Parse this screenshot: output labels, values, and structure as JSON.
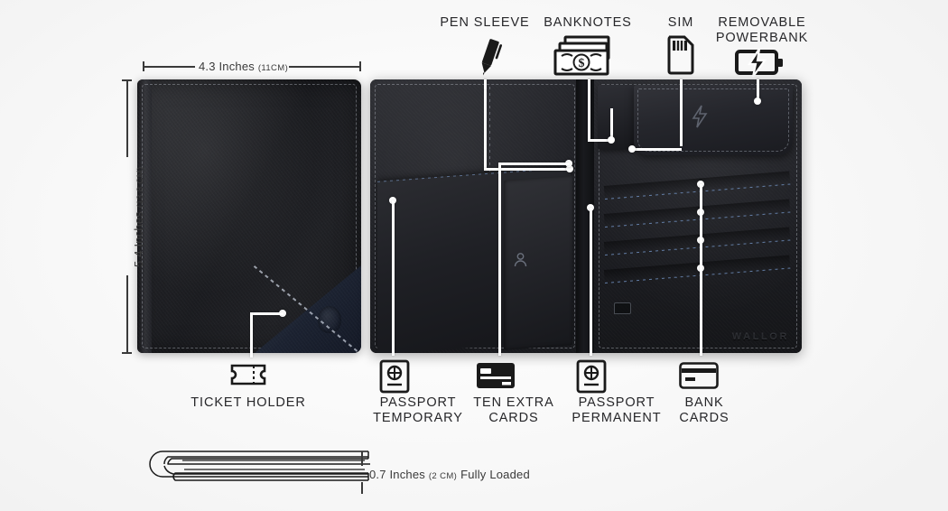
{
  "background_color": "#fbfbfb",
  "brand": {
    "emboss_text": "WALLOR"
  },
  "top_features": [
    {
      "id": "pen-sleeve",
      "label": "PEN SLEEVE",
      "icon": "pen-icon"
    },
    {
      "id": "banknotes",
      "label": "BANKNOTES",
      "icon": "banknotes-icon"
    },
    {
      "id": "sim",
      "label": "SIM",
      "icon": "sim-card-icon"
    },
    {
      "id": "removable-powerbank",
      "label": "REMOVABLE\nPOWERBANK",
      "icon": "battery-bolt-icon"
    }
  ],
  "bottom_features": [
    {
      "id": "ticket-holder",
      "label": "TICKET HOLDER",
      "icon": "ticket-icon"
    },
    {
      "id": "passport-temporary",
      "label": "PASSPORT\nTEMPORARY",
      "icon": "passport-icon"
    },
    {
      "id": "ten-extra-cards",
      "label": "TEN EXTRA\nCARDS",
      "icon": "card-filled-icon"
    },
    {
      "id": "passport-permanent",
      "label": "PASSPORT\nPERMANENT",
      "icon": "passport-icon"
    },
    {
      "id": "bank-cards",
      "label": "BANK\nCARDS",
      "icon": "card-outline-icon"
    }
  ],
  "dimensions": {
    "width": {
      "value": "4.3 Inches",
      "metric": "(11CM)"
    },
    "height": {
      "value": "5.4 Inches",
      "metric": "(13.8 CM)"
    },
    "thickness": {
      "value": "0.7 Inches",
      "metric": "(2 CM)",
      "note": "Fully Loaded"
    }
  },
  "products": {
    "closed_wallet": {
      "name": "closed-wallet",
      "leather_color": "#1c1d21",
      "accent_color": "#1d2433"
    },
    "open_wallet": {
      "name": "open-wallet",
      "leather_color": "#1e1f24",
      "stitch_color": "#7496c8"
    }
  }
}
